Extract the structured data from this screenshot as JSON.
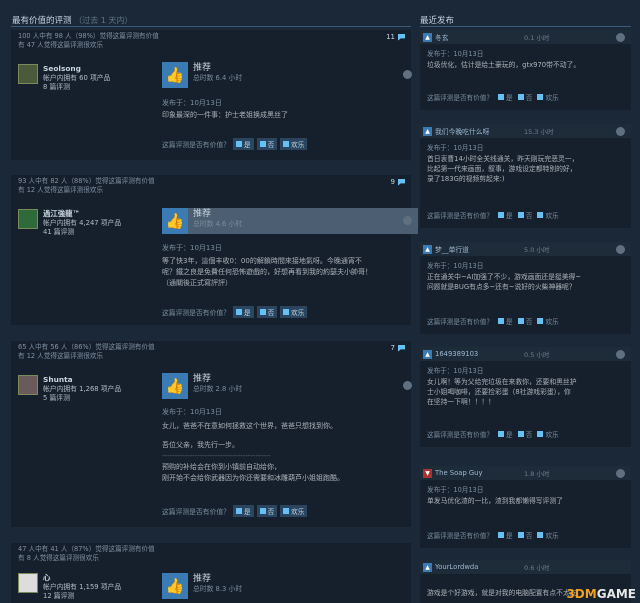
{
  "left_header": {
    "title": "最有价值的评测",
    "subtitle": "（过去 1 天内）"
  },
  "right_header": {
    "title": "最近发布"
  },
  "reviews": [
    {
      "meta1": "100 人中有 98 人（98%）觉得这篇评测有价值",
      "meta2": "有 47 人觉得这篇评测很欢乐",
      "comments": "11",
      "author": "Seolsong",
      "owned": "帐户内拥有 60 项产品",
      "count": "8 篇评测",
      "rec": "推荐",
      "hours": "总时数 6.4 小时",
      "date": "发布于：10月13日",
      "text": [
        "印象最深的一件事：护士老姐换成黑丝了"
      ],
      "helpful": "这篇评测是否有价值？",
      "yes": "是",
      "no": "否",
      "funny": "欢乐"
    },
    {
      "meta1": "93 人中有 82 人（88%）觉得这篇评测有价值",
      "meta2": "有 12 人觉得这篇评测很欢乐",
      "comments": "9",
      "author": "過江強龍™",
      "owned": "帐户内拥有 4,247 项产品",
      "count": "41 篇评测",
      "rec": "推荐",
      "hours": "总时数 4.6 小时",
      "date": "发布于：10月13日",
      "text": [
        "等了快3年，這個丰收0：00的解鎖時間來接地氣呀。今晚通宵不",
        "呢？鐵之良是免費任何恐怖遊戲的，好想再看到我的約瑟夫小帥哥！",
        "（通關後正式寫評評）"
      ],
      "helpful": "这篇评测是否有价值？",
      "yes": "是",
      "no": "否",
      "funny": "欢乐"
    },
    {
      "meta1": "65 人中有 56 人（86%）觉得这篇评测有价值",
      "meta2": "有 12 人觉得这篇评测很欢乐",
      "comments": "7",
      "author": "Shunta",
      "owned": "帐户内拥有 1,268 项产品",
      "count": "5 篇评测",
      "rec": "推荐",
      "hours": "总时数 2.8 小时",
      "date": "发布于：10月13日",
      "text": [
        "女儿，爸爸不在意如何拯救这个世界，爸爸只想找到你。",
        "",
        "吾位父亲，我先行一步。",
        "-------------------------------------------",
        "预购的补给会在你到小镇前自动给你，",
        "刚开始不会给你武器因为你还需要和冰雕葫芦小姐姐跑酷。"
      ],
      "helpful": "这篇评测是否有价值？",
      "yes": "是",
      "no": "否",
      "funny": "欢乐"
    },
    {
      "meta1": "47 人中有 41 人（87%）觉得这篇评测有价值",
      "meta2": "有 8 人觉得这篇评测很欢乐",
      "comments": "",
      "author": "心",
      "owned": "帐户内拥有 1,159 项产品",
      "count": "12 篇评测",
      "rec": "推荐",
      "hours": "总时数 8.3 小时"
    }
  ],
  "recent": [
    {
      "name": "冬玄",
      "hours": "0.1 小时",
      "up": true,
      "date": "发布于：10月13日",
      "text": [
        "垃圾优化，估计是给土豪玩的，gtx970带不动了。"
      ]
    },
    {
      "name": "我们今晚吃什么呀",
      "hours": "15.3 小时",
      "up": true,
      "date": "发布于：10月13日",
      "text": [
        "首日衷曹14小时全关线通关，昨天刚玩完恶灵一，",
        "比起第一代来画面，叙事，游戏设定都特别的好，",
        "录了183G的视频剪起来:)"
      ]
    },
    {
      "name": "梦__单行道",
      "hours": "5.0 小时",
      "up": true,
      "date": "发布于：10月13日",
      "text": [
        "正在通关中~AI加强了不少，游戏画面还是挺美得~",
        "问题就是BUG有点多~还有~说好的火柴神器呢？"
      ]
    },
    {
      "name": "1649389103",
      "hours": "0.5 小时",
      "up": true,
      "date": "发布于：10月13日",
      "text": [
        "女儿啊！等为父给完垃圾在来救你，还要和黑丝护",
        "士小姐喝咖啡，还要捡彩蛋（8社游戏彩蛋），你",
        "在坚持一下啊！！！！"
      ]
    },
    {
      "name": "The Soap Guy",
      "hours": "1.8 小时",
      "up": false,
      "date": "发布于：10月13日",
      "text": [
        "单发马优化渣的一比，渣到我都懒得写评测了"
      ]
    },
    {
      "name": "YourLordwda",
      "hours": "0.6 小时",
      "up": true,
      "date": "",
      "text": [
        "游戏是个好游戏，就是对我的电脑配置有点不太友"
      ]
    }
  ],
  "right_helpful": {
    "label": "这篇评测是否有价值？",
    "yes": "是",
    "no": "否",
    "funny": "欢乐"
  },
  "watermark": {
    "a": "3DM",
    "b": "GAME"
  }
}
